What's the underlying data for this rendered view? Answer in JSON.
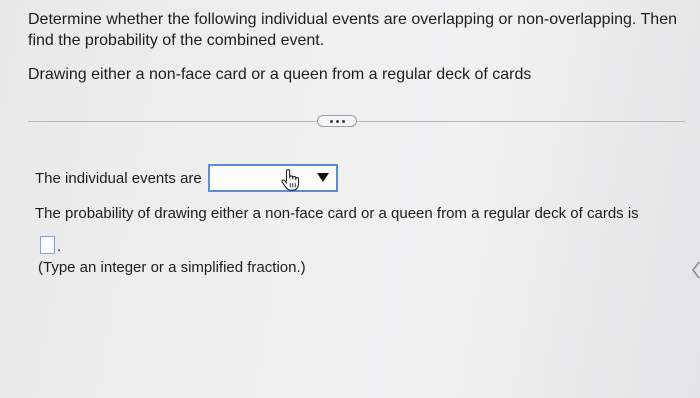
{
  "question": {
    "instructions": "Determine whether the following individual events are overlapping or non-overlapping. Then find the probability of the combined event.",
    "event": "Drawing either a non-face card or a queen from a regular deck of cards"
  },
  "divider": {
    "more_icon": "ellipsis-icon"
  },
  "answer": {
    "events_label": "The individual events are",
    "dropdown_value": "",
    "probability_prompt": "The probability of drawing either a non-face card or a queen from a regular deck of cards is",
    "probability_value": "",
    "period": ".",
    "hint": "(Type an integer or a simplified fraction.)",
    "pointer_icon": "hand-pointer-icon"
  },
  "colors": {
    "input_border": "#5b8fd4",
    "text": "#1d1d1d",
    "background": "#efeff0"
  }
}
